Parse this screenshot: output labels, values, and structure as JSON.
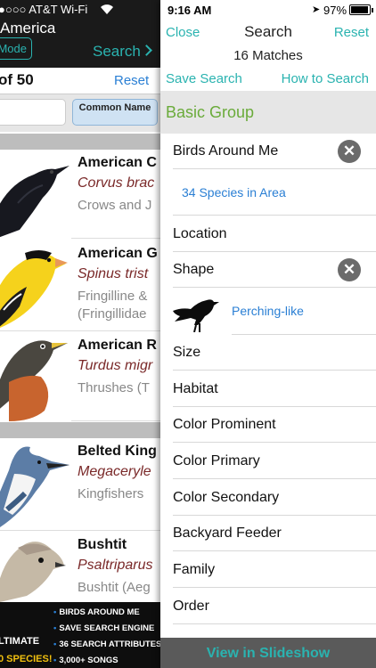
{
  "background_app": {
    "status": {
      "carrier": "●○○○ AT&T Wi-Fi"
    },
    "nav": {
      "title": "America",
      "mode_label": "Mode",
      "search_label": "Search"
    },
    "count_label": "of 50",
    "reset_label": "Reset",
    "common_name_label": "Common Name",
    "species": [
      {
        "name": "American C",
        "scientific": "Corvus brac",
        "family": "Crows and J"
      },
      {
        "name": "American G",
        "scientific": "Spinus trist",
        "family": "Fringilline &",
        "family2": "(Fringillidae"
      },
      {
        "name": "American R",
        "scientific": "Turdus migr",
        "family": "Thrushes (T"
      },
      {
        "name": "Belted King",
        "scientific": "Megaceryle",
        "family": "Kingfishers"
      },
      {
        "name": "Bushtit",
        "scientific": "Psaltriparus",
        "family": "Bushtit (Aeg"
      }
    ],
    "banner": {
      "features": [
        "BIRDS AROUND ME",
        "SAVE SEARCH ENGINE",
        "36 SEARCH ATTRIBUTES",
        "3,000+ SONGS"
      ],
      "left_line1": "LTIMATE",
      "left_line2": "0 SPECIES!"
    }
  },
  "status": {
    "time": "9:16 AM",
    "battery": "97%"
  },
  "header": {
    "close_label": "Close",
    "title": "Search",
    "reset_label": "Reset",
    "matches": "16 Matches",
    "save_search_label": "Save Search",
    "how_to_label": "How to Search"
  },
  "group_title": "Basic Group",
  "attributes": {
    "birds_around_me": "Birds Around Me",
    "species_in_area": "34 Species in Area",
    "location": "Location",
    "shape": "Shape",
    "shape_value": "Perching-like",
    "size": "Size",
    "habitat": "Habitat",
    "color_prominent": "Color Prominent",
    "color_primary": "Color Primary",
    "color_secondary": "Color Secondary",
    "backyard_feeder": "Backyard Feeder",
    "family": "Family",
    "order": "Order"
  },
  "footer_label": "View in Slideshow",
  "colors": {
    "accent": "#2ab3b0",
    "link": "#2a7fd4",
    "group": "#6aab3a"
  }
}
